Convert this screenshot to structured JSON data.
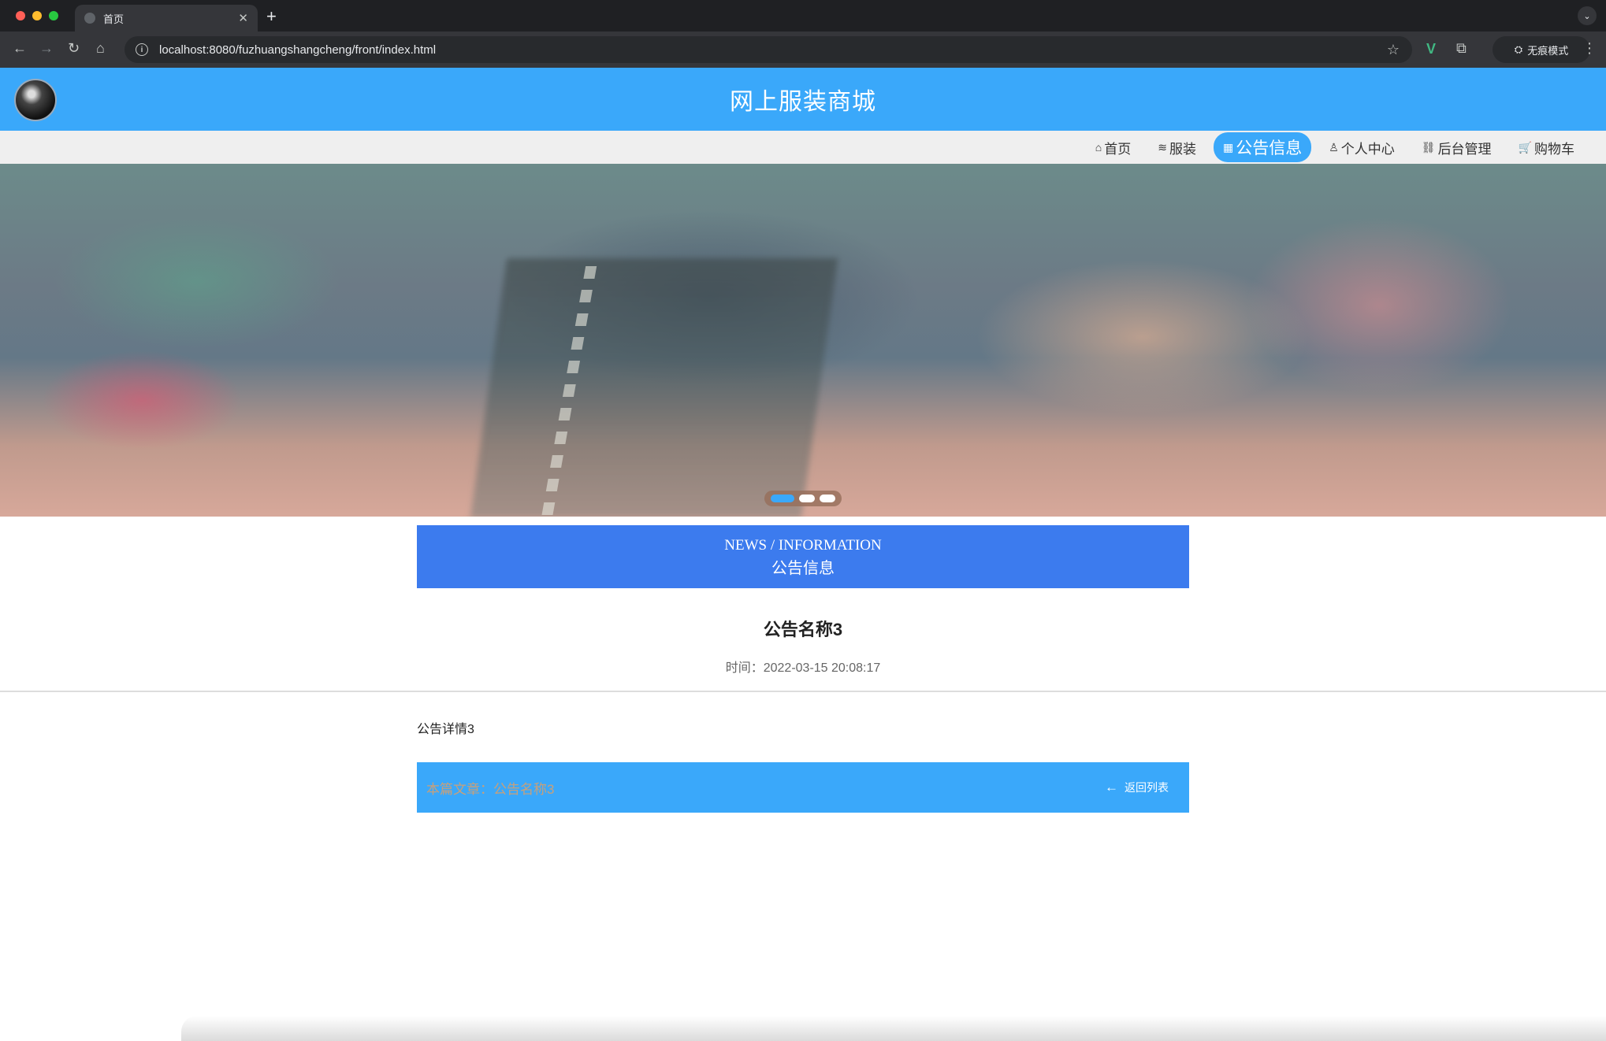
{
  "browser": {
    "tab_title": "首页",
    "url": "localhost:8080/fuzhuangshangcheng/front/index.html",
    "incognito_label": "无痕模式",
    "traffic_colors": [
      "#ff5f57",
      "#febc2e",
      "#28c840"
    ]
  },
  "header": {
    "site_title": "网上服装商城"
  },
  "nav": {
    "items": [
      {
        "label": "首页",
        "icon": "home-icon",
        "glyph": "⌂"
      },
      {
        "label": "服装",
        "icon": "layers-icon",
        "glyph": "≋"
      },
      {
        "label": "公告信息",
        "icon": "grid-icon",
        "glyph": "▦"
      },
      {
        "label": "个人中心",
        "icon": "user-icon",
        "glyph": "♙"
      },
      {
        "label": "后台管理",
        "icon": "link-icon",
        "glyph": "⛓"
      },
      {
        "label": "购物车",
        "icon": "cart-icon",
        "glyph": "🛒"
      }
    ],
    "active_index": 2
  },
  "carousel": {
    "slide_count": 3,
    "active_index": 0
  },
  "section": {
    "title_en": "NEWS / INFORMATION",
    "title_zh": "公告信息"
  },
  "article": {
    "title": "公告名称3",
    "time_label": "时间：",
    "time_value": "2022-03-15 20:08:17",
    "body": "公告详情3"
  },
  "footer_bar": {
    "current_label": "本篇文章：",
    "current_value": "公告名称3",
    "back_label": "返回列表"
  },
  "colors": {
    "primary": "#3aa8fa",
    "section_head": "#3c7bee"
  }
}
